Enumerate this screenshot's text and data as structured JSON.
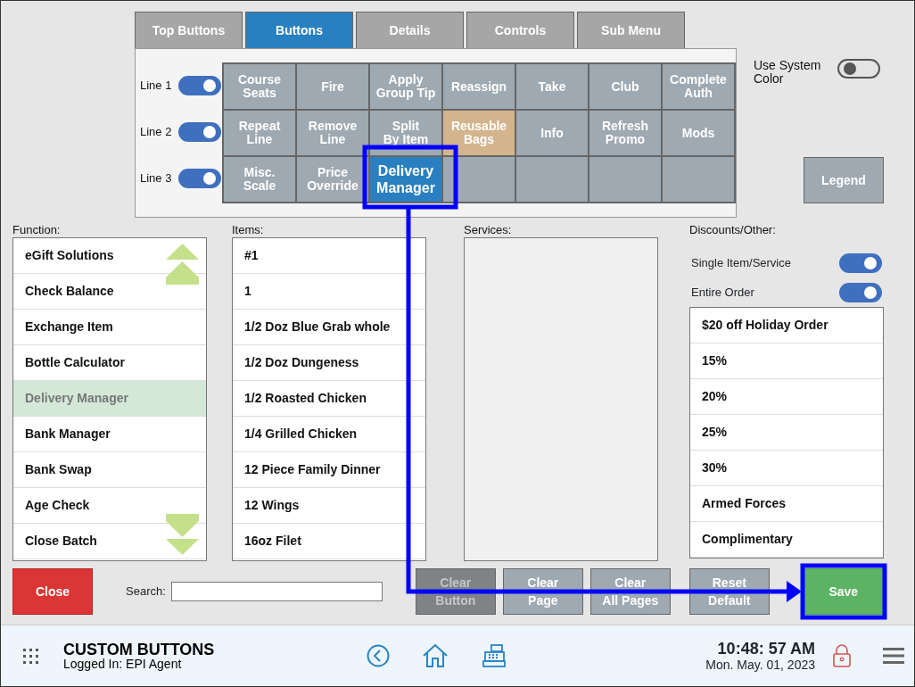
{
  "tabs": [
    {
      "label": "Top Buttons",
      "selected": false
    },
    {
      "label": "Buttons",
      "selected": true
    },
    {
      "label": "Details",
      "selected": false
    },
    {
      "label": "Controls",
      "selected": false
    },
    {
      "label": "Sub Menu",
      "selected": false
    }
  ],
  "system_color": {
    "label": "Use System Color",
    "on": false
  },
  "lines": [
    {
      "label": "Line 1",
      "on": true
    },
    {
      "label": "Line 2",
      "on": true
    },
    {
      "label": "Line 3",
      "on": true
    }
  ],
  "grid": [
    [
      {
        "label": "Course\nSeats",
        "kind": "normal"
      },
      {
        "label": "Fire",
        "kind": "normal"
      },
      {
        "label": "Apply\nGroup Tip",
        "kind": "normal"
      },
      {
        "label": "Reassign",
        "kind": "normal"
      },
      {
        "label": "Take",
        "kind": "normal"
      },
      {
        "label": "Club",
        "kind": "normal"
      },
      {
        "label": "Complete\nAuth",
        "kind": "normal"
      }
    ],
    [
      {
        "label": "Repeat\nLine",
        "kind": "normal"
      },
      {
        "label": "Remove\nLine",
        "kind": "normal"
      },
      {
        "label": "Split\nBy Item",
        "kind": "normal"
      },
      {
        "label": "Reusable\nBags",
        "kind": "special"
      },
      {
        "label": "Info",
        "kind": "normal"
      },
      {
        "label": "Refresh\nPromo",
        "kind": "normal"
      },
      {
        "label": "Mods",
        "kind": "normal"
      }
    ],
    [
      {
        "label": "Misc.\nScale",
        "kind": "normal"
      },
      {
        "label": "Price\nOverride",
        "kind": "normal"
      },
      {
        "label": "Delivery\nManager",
        "kind": "selected"
      },
      {
        "kind": "empty"
      },
      {
        "kind": "empty"
      },
      {
        "kind": "empty"
      },
      {
        "kind": "empty"
      }
    ]
  ],
  "legend_button": "Legend",
  "function_list": {
    "label": "Function:",
    "items": [
      {
        "label": "eGift Solutions",
        "selected": false
      },
      {
        "label": "Check Balance",
        "selected": false
      },
      {
        "label": "Exchange Item",
        "selected": false
      },
      {
        "label": "Bottle Calculator",
        "selected": false
      },
      {
        "label": "Delivery Manager",
        "selected": true
      },
      {
        "label": "Bank Manager",
        "selected": false
      },
      {
        "label": "Bank Swap",
        "selected": false
      },
      {
        "label": "Age Check",
        "selected": false
      },
      {
        "label": "Close Batch",
        "selected": false
      }
    ]
  },
  "items_list": {
    "label": "Items:",
    "items": [
      "#1",
      "1",
      "1/2 Doz Blue Grab whole",
      "1/2 Doz Dungeness",
      "1/2 Roasted Chicken",
      "1/4 Grilled Chicken",
      "12 Piece Family Dinner",
      "12 Wings",
      "16oz Filet"
    ]
  },
  "services_list": {
    "label": "Services:"
  },
  "discounts": {
    "label": "Discounts/Other:",
    "options": [
      {
        "label": "Single Item/Service",
        "on": true
      },
      {
        "label": "Entire Order",
        "on": true
      }
    ],
    "items": [
      "$20 off Holiday Order",
      "15%",
      "20%",
      "25%",
      "30%",
      "Armed Forces",
      "Complimentary"
    ]
  },
  "close_button": "Close",
  "search": {
    "label": "Search:"
  },
  "actions": [
    {
      "label": "Clear\nButton",
      "disabled": true
    },
    {
      "label": "Clear\nPage",
      "disabled": false
    },
    {
      "label": "Clear\nAll Pages",
      "disabled": false
    },
    {
      "label": "Reset\nDefault",
      "disabled": false
    }
  ],
  "save_button": "Save",
  "status_bar": {
    "title": "CUSTOM BUTTONS",
    "logged_in": "Logged In:  EPI Agent",
    "time": "10:48: 57 AM",
    "date": "Mon. May. 01, 2023"
  }
}
